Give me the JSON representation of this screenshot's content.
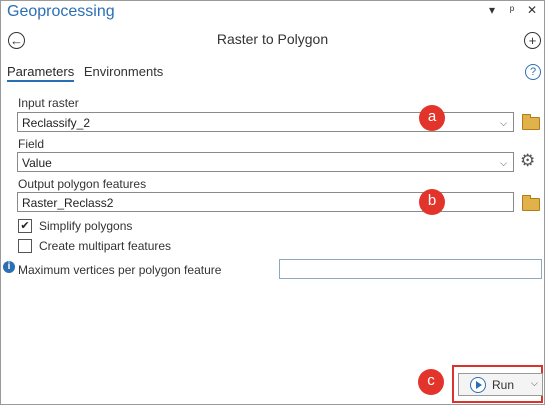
{
  "window": {
    "title": "Geoprocessing",
    "controls": [
      "▾",
      "ᵖ",
      "✕"
    ]
  },
  "tool": {
    "name": "Raster to Polygon",
    "back_icon": "back-circle-icon",
    "add_icon": "add-circle-icon"
  },
  "tabs": [
    {
      "label": "Parameters",
      "active": true
    },
    {
      "label": "Environments",
      "active": false
    }
  ],
  "help_glyph": "?",
  "params": {
    "input_raster": {
      "label": "Input raster",
      "value": "Reclassify_2"
    },
    "field": {
      "label": "Field",
      "value": "Value"
    },
    "output": {
      "label": "Output polygon features",
      "value": "Raster_Reclass2"
    },
    "simplify": {
      "label": "Simplify polygons",
      "checked": true
    },
    "multipart": {
      "label": "Create multipart features",
      "checked": false
    },
    "max_vertices": {
      "label": "Maximum vertices per polygon feature",
      "value": ""
    }
  },
  "badges": {
    "a": "a",
    "b": "b",
    "c": "c"
  },
  "run": {
    "label": "Run"
  },
  "colors": {
    "accent": "#2a6fb3",
    "badge": "#e3342b",
    "highlight": "#d9342b"
  }
}
